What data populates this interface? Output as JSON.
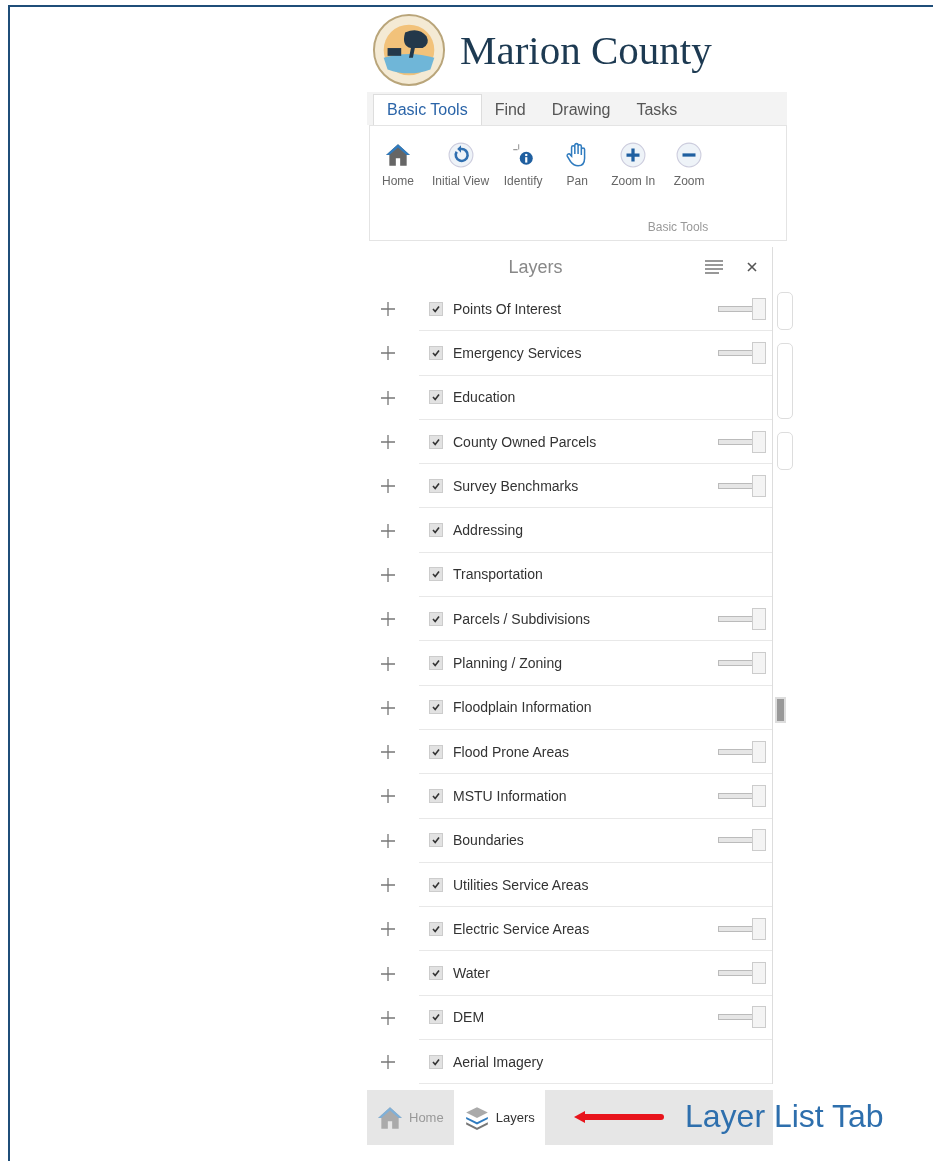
{
  "header": {
    "title": "Marion County"
  },
  "ribbon": {
    "tabs": [
      {
        "label": "Basic Tools",
        "selected": true
      },
      {
        "label": "Find",
        "selected": false
      },
      {
        "label": "Drawing",
        "selected": false
      },
      {
        "label": "Tasks",
        "selected": false
      }
    ],
    "tools": [
      {
        "label": "Home"
      },
      {
        "label": "Initial View"
      },
      {
        "label": "Identify"
      },
      {
        "label": "Pan"
      },
      {
        "label": "Zoom In"
      },
      {
        "label": "Zoom"
      }
    ],
    "group_label": "Basic Tools"
  },
  "layers_panel": {
    "title": "Layers",
    "layers": [
      {
        "name": "Points Of Interest",
        "checked": true,
        "kind": "slider",
        "level": 1
      },
      {
        "name": "Emergency Services",
        "checked": true,
        "kind": "slider",
        "level": 1
      },
      {
        "name": "Education",
        "checked": true,
        "kind": "plain"
      },
      {
        "name": "County Owned Parcels",
        "checked": true,
        "kind": "slider",
        "level": 1
      },
      {
        "name": "Survey Benchmarks",
        "checked": true,
        "kind": "slider",
        "level": 1
      },
      {
        "name": "Addressing",
        "checked": true,
        "kind": "plain"
      },
      {
        "name": "Transportation",
        "checked": true,
        "kind": "plain"
      },
      {
        "name": "Parcels / Subdivisions",
        "checked": true,
        "kind": "slider",
        "level": 1
      },
      {
        "name": "Planning / Zoning",
        "checked": true,
        "kind": "slider",
        "level": 1
      },
      {
        "name": "Floodplain Information",
        "checked": true,
        "kind": "plain"
      },
      {
        "name": "Flood Prone Areas",
        "checked": true,
        "kind": "slider",
        "level": 1
      },
      {
        "name": "MSTU Information",
        "checked": true,
        "kind": "slider",
        "level": 1
      },
      {
        "name": "Boundaries",
        "checked": true,
        "kind": "slider",
        "level": 1
      },
      {
        "name": "Utilities Service Areas",
        "checked": true,
        "kind": "plain"
      },
      {
        "name": "Electric Service Areas",
        "checked": true,
        "kind": "slider",
        "level": 1
      },
      {
        "name": "Water",
        "checked": true,
        "kind": "slider",
        "level": 1
      },
      {
        "name": "DEM",
        "checked": true,
        "kind": "slider",
        "level": 1
      },
      {
        "name": "Aerial Imagery",
        "checked": true,
        "kind": "plain"
      }
    ]
  },
  "bottom_tabs": [
    {
      "label": "Home",
      "selected": false
    },
    {
      "label": "Layers",
      "selected": true
    }
  ],
  "annotation": {
    "text": "Layer List Tab"
  }
}
